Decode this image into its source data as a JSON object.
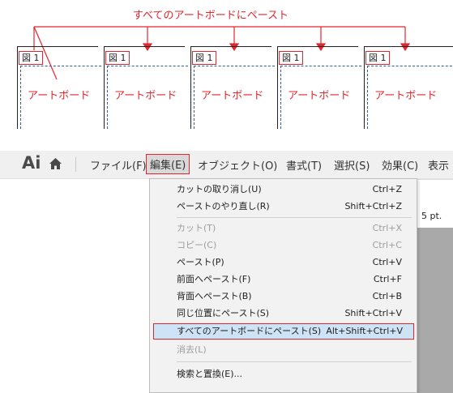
{
  "diagram": {
    "caption": "すべてのアートボードにペースト",
    "figure_label": "図 1",
    "artboard_label": "アートボード",
    "artboards": [
      1,
      2,
      3,
      4,
      5
    ]
  },
  "menubar": {
    "logo": "Ai",
    "items": [
      "ファイル(F)",
      "編集(E)",
      "オブジェクト(O)",
      "書式(T)",
      "選択(S)",
      "効果(C)",
      "表示"
    ]
  },
  "doc": {
    "stroke_value": "5 pt."
  },
  "edit_menu": {
    "items": [
      {
        "label": "カットの取り消し(U)",
        "shortcut": "Ctrl+Z",
        "state": "enabled"
      },
      {
        "label": "ペーストのやり直し(R)",
        "shortcut": "Shift+Ctrl+Z",
        "state": "enabled"
      },
      {
        "label": "カット(T)",
        "shortcut": "Ctrl+X",
        "state": "disabled"
      },
      {
        "label": "コピー(C)",
        "shortcut": "Ctrl+C",
        "state": "disabled"
      },
      {
        "label": "ペースト(P)",
        "shortcut": "Ctrl+V",
        "state": "enabled"
      },
      {
        "label": "前面へペースト(F)",
        "shortcut": "Ctrl+F",
        "state": "enabled"
      },
      {
        "label": "背面へペースト(B)",
        "shortcut": "Ctrl+B",
        "state": "enabled"
      },
      {
        "label": "同じ位置にペースト(S)",
        "shortcut": "Shift+Ctrl+V",
        "state": "enabled"
      },
      {
        "label": "すべてのアートボードにペースト(S)",
        "shortcut": "Alt+Shift+Ctrl+V",
        "state": "highlighted"
      },
      {
        "label": "消去(L)",
        "shortcut": "",
        "state": "disabled"
      },
      {
        "label": "検索と置換(E)...",
        "shortcut": "",
        "state": "enabled"
      }
    ]
  },
  "colors": {
    "accent_red": "#e3262d",
    "guide_blue": "#2f5dab",
    "highlight_bg": "#cfe3f7"
  }
}
